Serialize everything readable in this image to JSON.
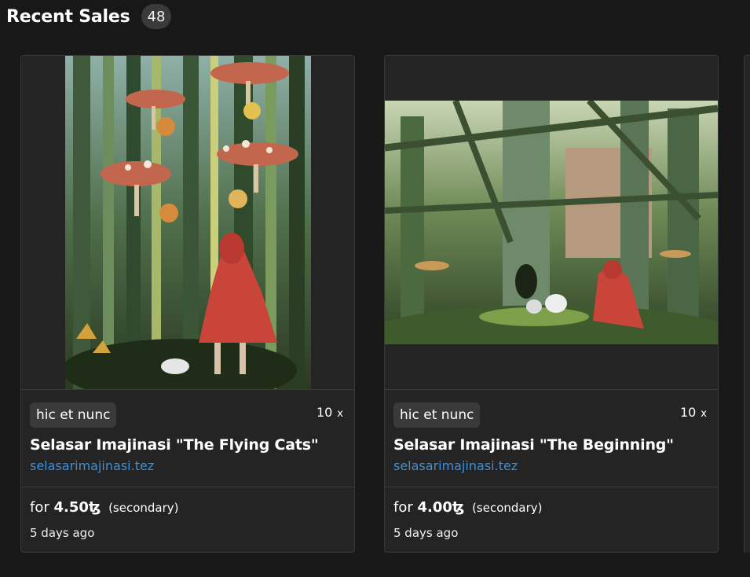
{
  "header": {
    "title": "Recent Sales",
    "count": "48"
  },
  "cards": [
    {
      "platform": "hic et nunc",
      "editions": "10",
      "editions_suffix": "x",
      "title": "Selasar Imajinasi \"The Flying Cats\"",
      "artist": "selasarimajinasi.tez",
      "price_prefix": "for",
      "price": "4.50ꜩ",
      "sale_type": "(secondary)",
      "time": "5 days ago",
      "image_icon": "artwork-forest-mushrooms-cats-image"
    },
    {
      "platform": "hic et nunc",
      "editions": "10",
      "editions_suffix": "x",
      "title": "Selasar Imajinasi \"The Beginning\"",
      "artist": "selasarimajinasi.tez",
      "price_prefix": "for",
      "price": "4.00ꜩ",
      "sale_type": "(secondary)",
      "time": "5 days ago",
      "image_icon": "artwork-forest-ruins-image"
    }
  ],
  "colors": {
    "background": "#181818",
    "card": "#242424",
    "link": "#3d8fd6",
    "tag": "#3a3a3a"
  }
}
